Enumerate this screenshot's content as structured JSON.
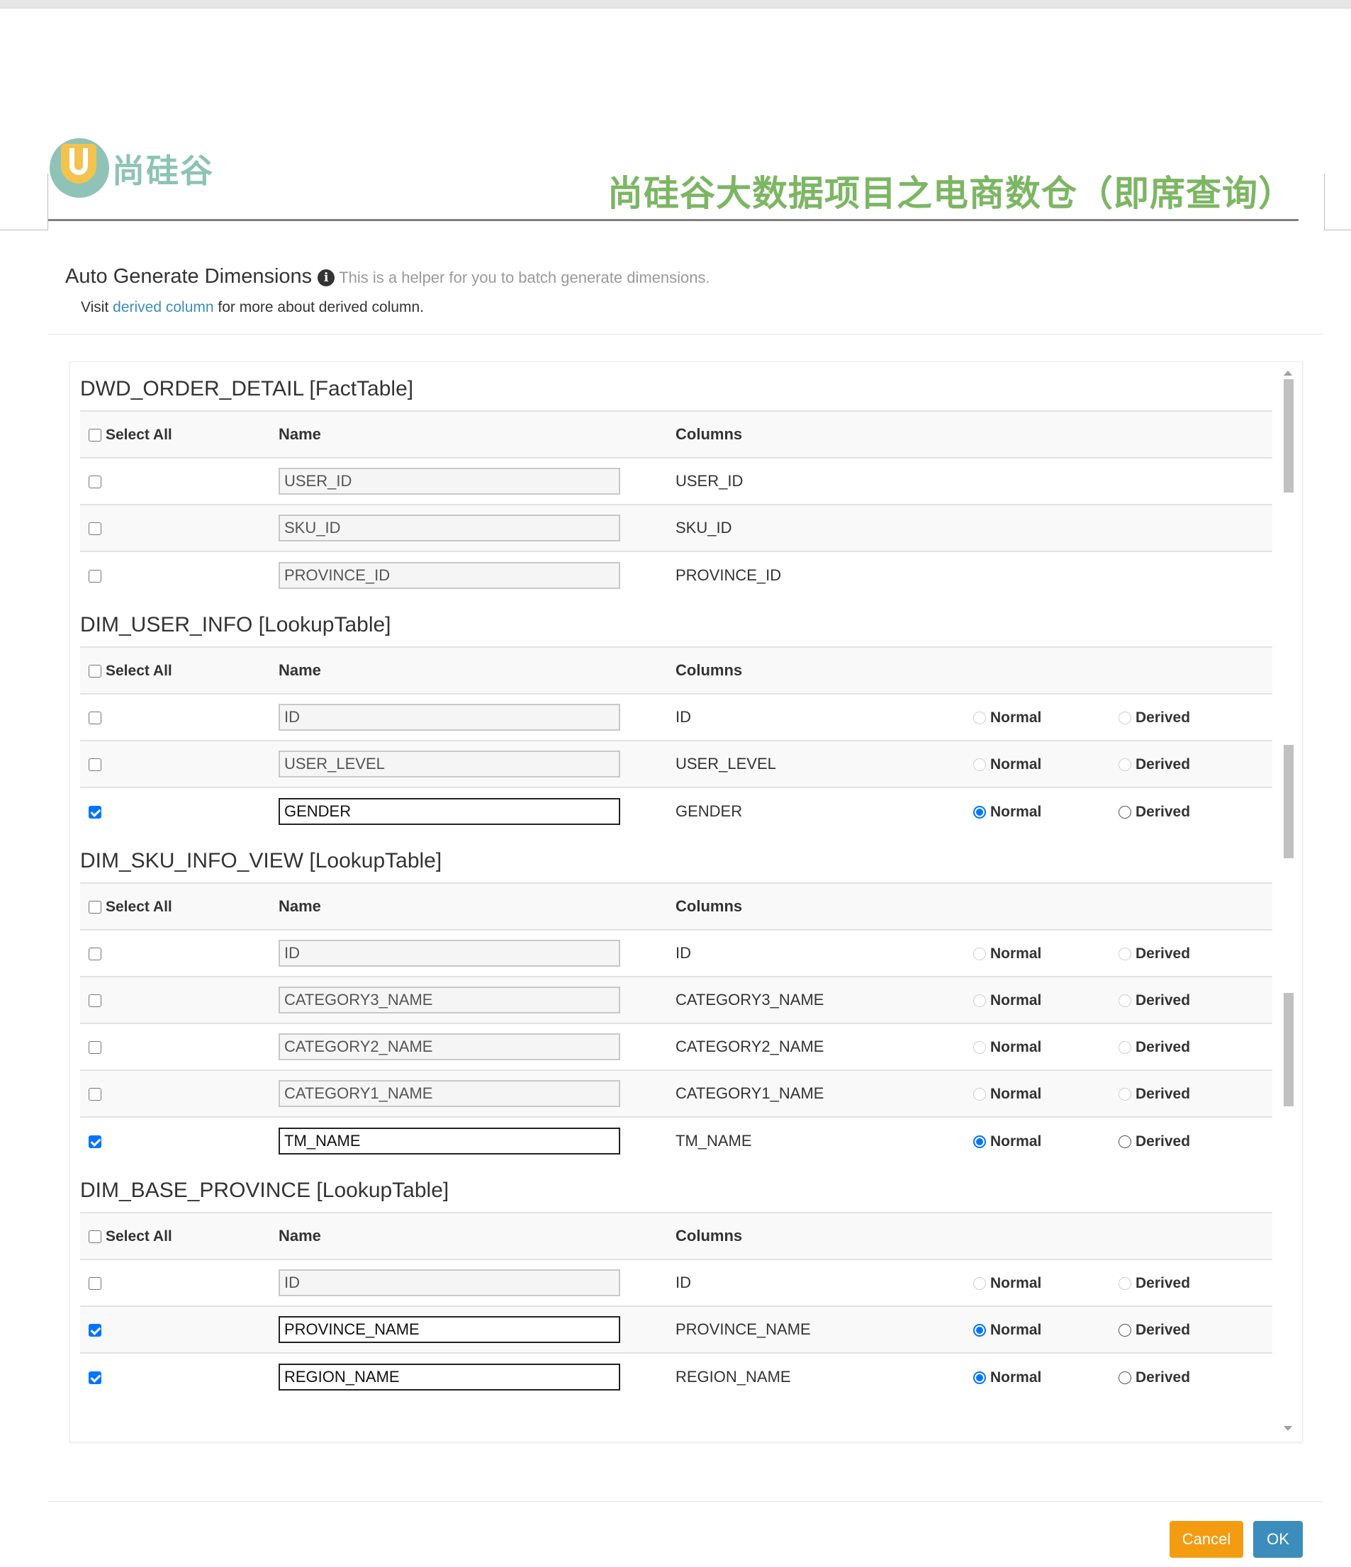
{
  "header": {
    "brand": "尚硅谷",
    "doc_title": "尚硅谷大数据项目之电商数仓（即席查询）"
  },
  "modal": {
    "title": "Auto Generate Dimensions",
    "helper": "This is a helper for you to batch generate dimensions.",
    "visit_prefix": "Visit",
    "visit_link": "derived column",
    "visit_suffix": "for more about derived column."
  },
  "headers": {
    "select_all": "Select All",
    "name": "Name",
    "columns": "Columns"
  },
  "labels": {
    "normal": "Normal",
    "derived": "Derived"
  },
  "tables": [
    {
      "title": "DWD_ORDER_DETAIL [FactTable]",
      "show_type": false,
      "rows": [
        {
          "checked": false,
          "name": "USER_ID",
          "column": "USER_ID",
          "type": null
        },
        {
          "checked": false,
          "name": "SKU_ID",
          "column": "SKU_ID",
          "type": null
        },
        {
          "checked": false,
          "name": "PROVINCE_ID",
          "column": "PROVINCE_ID",
          "type": null
        }
      ]
    },
    {
      "title": "DIM_USER_INFO [LookupTable]",
      "show_type": true,
      "rows": [
        {
          "checked": false,
          "name": "ID",
          "column": "ID",
          "type": null
        },
        {
          "checked": false,
          "name": "USER_LEVEL",
          "column": "USER_LEVEL",
          "type": null
        },
        {
          "checked": true,
          "name": "GENDER",
          "column": "GENDER",
          "type": "normal"
        }
      ]
    },
    {
      "title": "DIM_SKU_INFO_VIEW [LookupTable]",
      "show_type": true,
      "rows": [
        {
          "checked": false,
          "name": "ID",
          "column": "ID",
          "type": null
        },
        {
          "checked": false,
          "name": "CATEGORY3_NAME",
          "column": "CATEGORY3_NAME",
          "type": null
        },
        {
          "checked": false,
          "name": "CATEGORY2_NAME",
          "column": "CATEGORY2_NAME",
          "type": null
        },
        {
          "checked": false,
          "name": "CATEGORY1_NAME",
          "column": "CATEGORY1_NAME",
          "type": null
        },
        {
          "checked": true,
          "name": "TM_NAME",
          "column": "TM_NAME",
          "type": "normal"
        }
      ]
    },
    {
      "title": "DIM_BASE_PROVINCE [LookupTable]",
      "show_type": true,
      "rows": [
        {
          "checked": false,
          "name": "ID",
          "column": "ID",
          "type": null
        },
        {
          "checked": true,
          "name": "PROVINCE_NAME",
          "column": "PROVINCE_NAME",
          "type": "normal"
        },
        {
          "checked": true,
          "name": "REGION_NAME",
          "column": "REGION_NAME",
          "type": "normal"
        }
      ]
    }
  ],
  "footer": {
    "cancel": "Cancel",
    "ok": "OK"
  },
  "colors": {
    "accent_blue": "#0075ff",
    "link_blue": "#3c8dbc",
    "cancel_orange": "#f39c12",
    "title_green": "#7cb663",
    "brand_teal": "#8cc3b4"
  }
}
